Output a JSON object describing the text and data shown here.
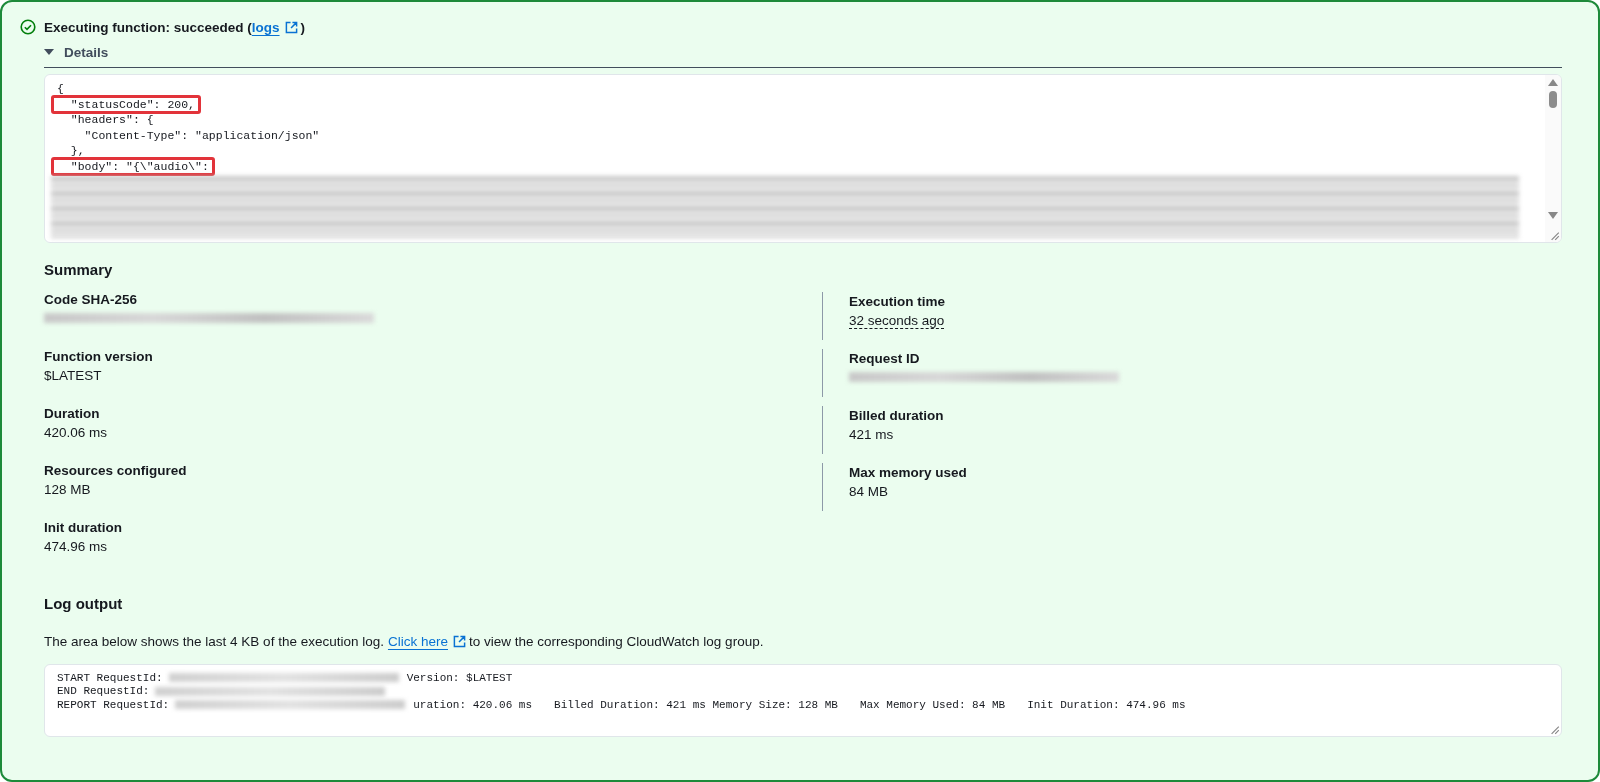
{
  "status": {
    "text": "Executing function: succeeded (",
    "link": "logs",
    "suffix": ")"
  },
  "details": {
    "label": "Details",
    "expanded": true,
    "code_lines": [
      {
        "text": "{",
        "highlighted": false
      },
      {
        "text": "  \"statusCode\": 200,",
        "highlighted": true
      },
      {
        "text": "  \"headers\": {",
        "highlighted": false
      },
      {
        "text": "    \"Content-Type\": \"application/json\"",
        "highlighted": false
      },
      {
        "text": "  },",
        "highlighted": false
      },
      {
        "text": "  \"body\": \"{\\\"audio\\\":",
        "highlighted": true
      }
    ]
  },
  "summary": {
    "title": "Summary",
    "left": [
      {
        "label": "Code SHA-256",
        "kind": "redacted"
      },
      {
        "label": "Function version",
        "value": "$LATEST",
        "kind": "text"
      },
      {
        "label": "Duration",
        "value": "420.06 ms",
        "kind": "text"
      },
      {
        "label": "Resources configured",
        "value": "128 MB",
        "kind": "text"
      },
      {
        "label": "Init duration",
        "value": "474.96 ms",
        "kind": "text"
      }
    ],
    "right": [
      {
        "label": "Execution time",
        "value": "32 seconds ago",
        "kind": "time"
      },
      {
        "label": "Request ID",
        "kind": "redacted"
      },
      {
        "label": "Billed duration",
        "value": "421 ms",
        "kind": "text"
      },
      {
        "label": "Max memory used",
        "value": "84 MB",
        "kind": "text"
      }
    ]
  },
  "log_output": {
    "title": "Log output",
    "intro": "The area below shows the last 4 KB of the execution log.",
    "link": "Click here",
    "outro": "to view the corresponding CloudWatch log group.",
    "lines": [
      [
        {
          "kind": "text",
          "text": "START RequestId:"
        },
        {
          "kind": "redacted"
        },
        {
          "kind": "text",
          "text": "Version: $LATEST"
        }
      ],
      [
        {
          "kind": "text",
          "text": "END RequestId:"
        },
        {
          "kind": "redacted"
        }
      ],
      [
        {
          "kind": "text",
          "text": "REPORT RequestId:"
        },
        {
          "kind": "redacted"
        },
        {
          "kind": "text",
          "text": "uration: 420.06 ms"
        },
        {
          "kind": "text",
          "text": "Billed Duration: 421 ms Memory Size: 128 MB"
        },
        {
          "kind": "text",
          "text": "Max Memory Used: 84 MB"
        },
        {
          "kind": "text",
          "text": "Init Duration: 474.96 ms"
        }
      ]
    ]
  }
}
